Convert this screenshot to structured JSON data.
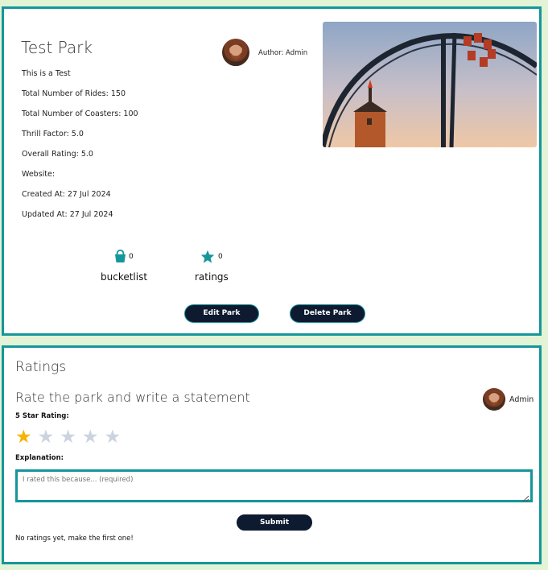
{
  "park": {
    "title": "Test Park",
    "description": "This is a Test",
    "total_rides": "Total Number of Rides: 150",
    "total_coasters": "Total Number of Coasters: 100",
    "thrill_factor": "Thrill Factor: 5.0",
    "overall_rating": "Overall Rating: 5.0",
    "website": "Website:",
    "created_at": "Created At: 27 Jul 2024",
    "updated_at": "Updated At: 27 Jul 2024",
    "author": "Author: Admin"
  },
  "stats": {
    "bucketlist_count": "0",
    "bucketlist_label": "bucketlist",
    "ratings_count": "0",
    "ratings_label": "ratings"
  },
  "actions": {
    "edit_label": "Edit Park",
    "delete_label": "Delete Park"
  },
  "ratings": {
    "heading": "Ratings",
    "prompt": "Rate the park and write a statement",
    "rater_name": "Admin",
    "star_label": "5 Star Rating:",
    "selected_stars": 1,
    "max_stars": 5,
    "explanation_label": "Explanation:",
    "explanation_placeholder": "I rated this because... (required)",
    "submit_label": "Submit",
    "empty_message": "No ratings yet, make the first one!"
  },
  "colors": {
    "accent": "#14969b",
    "button": "#0e1a30",
    "star_active": "#f5b400",
    "star_inactive": "#ccd3e0",
    "background": "#e3f4d6"
  }
}
